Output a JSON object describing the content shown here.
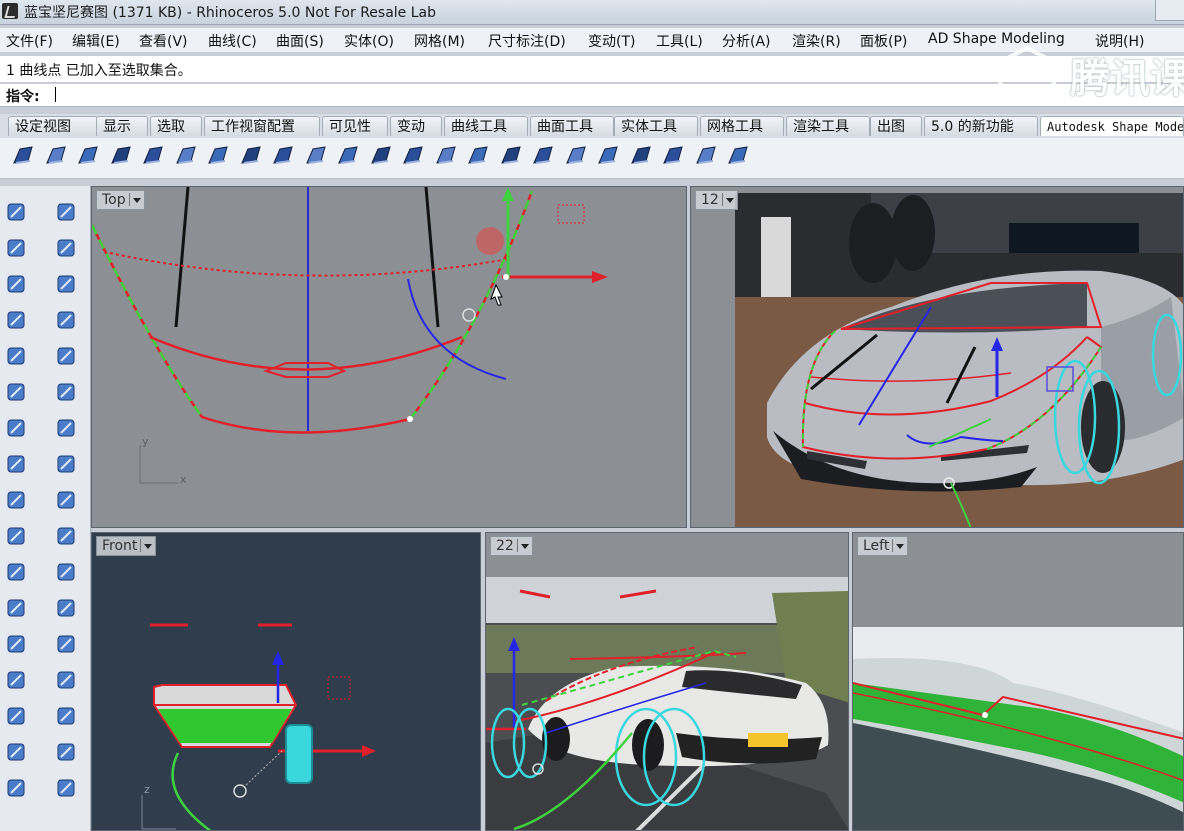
{
  "window": {
    "title": "蓝宝坚尼赛图 (1371 KB) - Rhinoceros 5.0 Not For Resale Lab"
  },
  "menu": [
    "文件(F)",
    "编辑(E)",
    "查看(V)",
    "曲线(C)",
    "曲面(S)",
    "实体(O)",
    "网格(M)",
    "尺寸标注(D)",
    "变动(T)",
    "工具(L)",
    "分析(A)",
    "渲染(R)",
    "面板(P)",
    "AD Shape Modeling",
    "说明(H)"
  ],
  "command": {
    "history": "1 曲线点 已加入至选取集合。",
    "prompt_label": "指令:",
    "value": ""
  },
  "watermark": {
    "text": "腾讯课"
  },
  "tabs": [
    "设定视图",
    "显示",
    "选取",
    "工作视窗配置",
    "可见性",
    "变动",
    "曲线工具",
    "曲面工具",
    "实体工具",
    "网格工具",
    "渲染工具",
    "出图",
    "5.0 的新功能",
    "Autodesk Shape Modeling"
  ],
  "toolbar_icons": [
    "blend-curve-icon",
    "extrude-icon",
    "sweep-icon",
    "loft-icon",
    "network-surface-icon",
    "planar-surface-icon",
    "patch-icon",
    "edge-surface-icon",
    "cap-icon",
    "revolve-icon",
    "rail-revolve-icon",
    "offset-surface-icon",
    "fillet-surface-icon",
    "chamfer-surface-icon",
    "rebuild-surface-icon",
    "match-surface-icon",
    "merge-surface-icon",
    "point-grid-icon",
    "curve-on-surface-icon",
    "pull-curve-icon",
    "blend-edge-icon",
    "split-icon",
    "visibility-icon"
  ],
  "left_tools": [
    "select-arrow-icon",
    "point-icon",
    "polyline-icon",
    "curve-from-points-icon",
    "circle-icon",
    "ellipse-icon",
    "polygon-icon",
    "rectangle-icon",
    "arc-icon",
    "fillet-curve-icon",
    "surface-from-corners-icon",
    "surface-edit-icon",
    "box-solid-icon",
    "sphere-solid-icon",
    "cylinder-solid-icon",
    "mesh-icon",
    "explode-icon",
    "split-icon",
    "move-icon",
    "boolean-icon",
    "analyze-icon",
    "dimension-icon",
    "text-icon",
    "scale-icon",
    "group-icon",
    "array-icon",
    "block-icon",
    "layer-icon",
    "grid-icon",
    "transform-icon",
    "render-icon",
    "check-icon",
    "material-icon",
    "light-icon"
  ],
  "viewports": {
    "top": {
      "label": "Top"
    },
    "v12": {
      "label": "12"
    },
    "front": {
      "label": "Front"
    },
    "v22": {
      "label": "22"
    },
    "left": {
      "label": "Left"
    }
  },
  "axis_labels": {
    "y": "y",
    "x": "x",
    "z": "z"
  },
  "colors": {
    "viewport_bg": "#8c8f93",
    "front_bg": "#2f3d4c",
    "curve_red": "#e0202a",
    "curve_green": "#3fd23f",
    "curve_blue": "#2626e6",
    "cyan": "#3ad7df"
  }
}
